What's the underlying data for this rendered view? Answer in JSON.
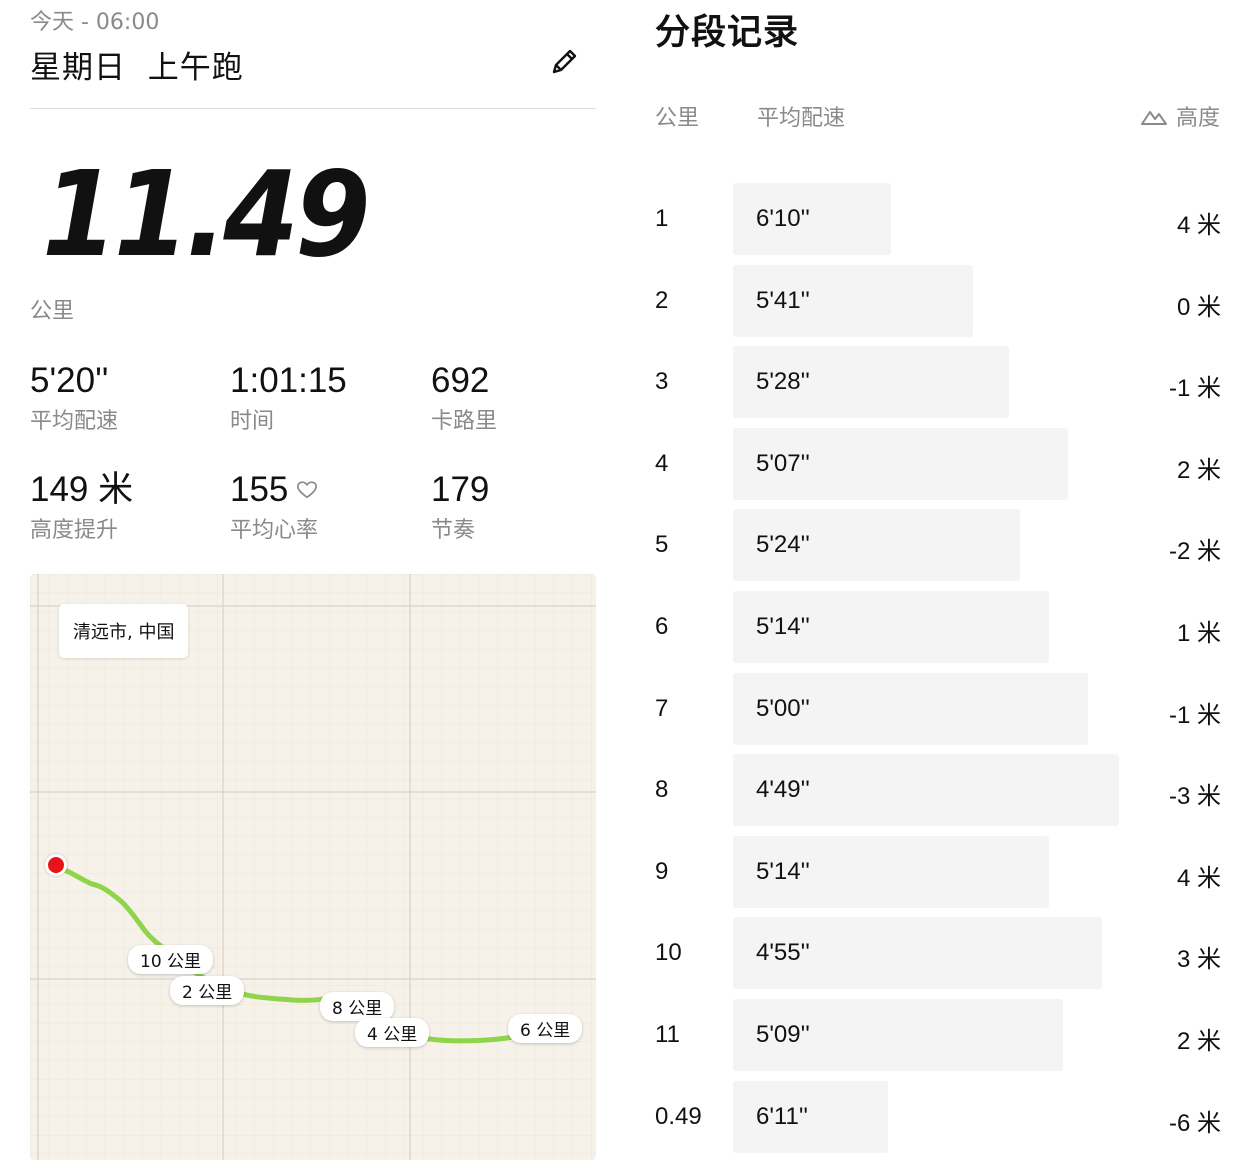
{
  "header": {
    "date_time": "今天 - 06:00",
    "title": "星期日  上午跑",
    "edit_icon": "pencil-icon"
  },
  "summary": {
    "distance": "11.49",
    "distance_unit": "公里",
    "stats": [
      {
        "value": "5'20''",
        "label": "平均配速"
      },
      {
        "value": "1:01:15",
        "label": "时间"
      },
      {
        "value": "692",
        "label": "卡路里"
      },
      {
        "value": "149 米",
        "label": "高度提升"
      },
      {
        "value": "155",
        "label": "平均心率",
        "icon": "heart-outline-icon"
      },
      {
        "value": "179",
        "label": "节奏"
      }
    ]
  },
  "map": {
    "city_label": "清远市, 中国",
    "route_color": "#8fd44a",
    "start_color": "#e8141b",
    "km_markers": [
      {
        "label": "10 公里"
      },
      {
        "label": "2 公里"
      },
      {
        "label": "8 公里"
      },
      {
        "label": "4 公里"
      },
      {
        "label": "6 公里"
      }
    ]
  },
  "splits": {
    "title": "分段记录",
    "col_km": "公里",
    "col_pace": "平均配速",
    "col_elev": "高度",
    "elev_icon": "mountain-icon",
    "rows": [
      {
        "km": "1",
        "pace": "6'10''",
        "pace_seconds": 370,
        "elev": "4 米"
      },
      {
        "km": "2",
        "pace": "5'41''",
        "pace_seconds": 341,
        "elev": "0 米"
      },
      {
        "km": "3",
        "pace": "5'28''",
        "pace_seconds": 328,
        "elev": "-1 米"
      },
      {
        "km": "4",
        "pace": "5'07''",
        "pace_seconds": 307,
        "elev": "2 米"
      },
      {
        "km": "5",
        "pace": "5'24''",
        "pace_seconds": 324,
        "elev": "-2 米"
      },
      {
        "km": "6",
        "pace": "5'14''",
        "pace_seconds": 314,
        "elev": "1 米"
      },
      {
        "km": "7",
        "pace": "5'00''",
        "pace_seconds": 300,
        "elev": "-1 米"
      },
      {
        "km": "8",
        "pace": "4'49''",
        "pace_seconds": 289,
        "elev": "-3 米"
      },
      {
        "km": "9",
        "pace": "5'14''",
        "pace_seconds": 314,
        "elev": "4 米"
      },
      {
        "km": "10",
        "pace": "4'55''",
        "pace_seconds": 295,
        "elev": "3 米"
      },
      {
        "km": "11",
        "pace": "5'09''",
        "pace_seconds": 309,
        "elev": "2 米"
      },
      {
        "km": "0.49",
        "pace": "6'11''",
        "pace_seconds": 371,
        "elev": "-6 米"
      }
    ]
  }
}
